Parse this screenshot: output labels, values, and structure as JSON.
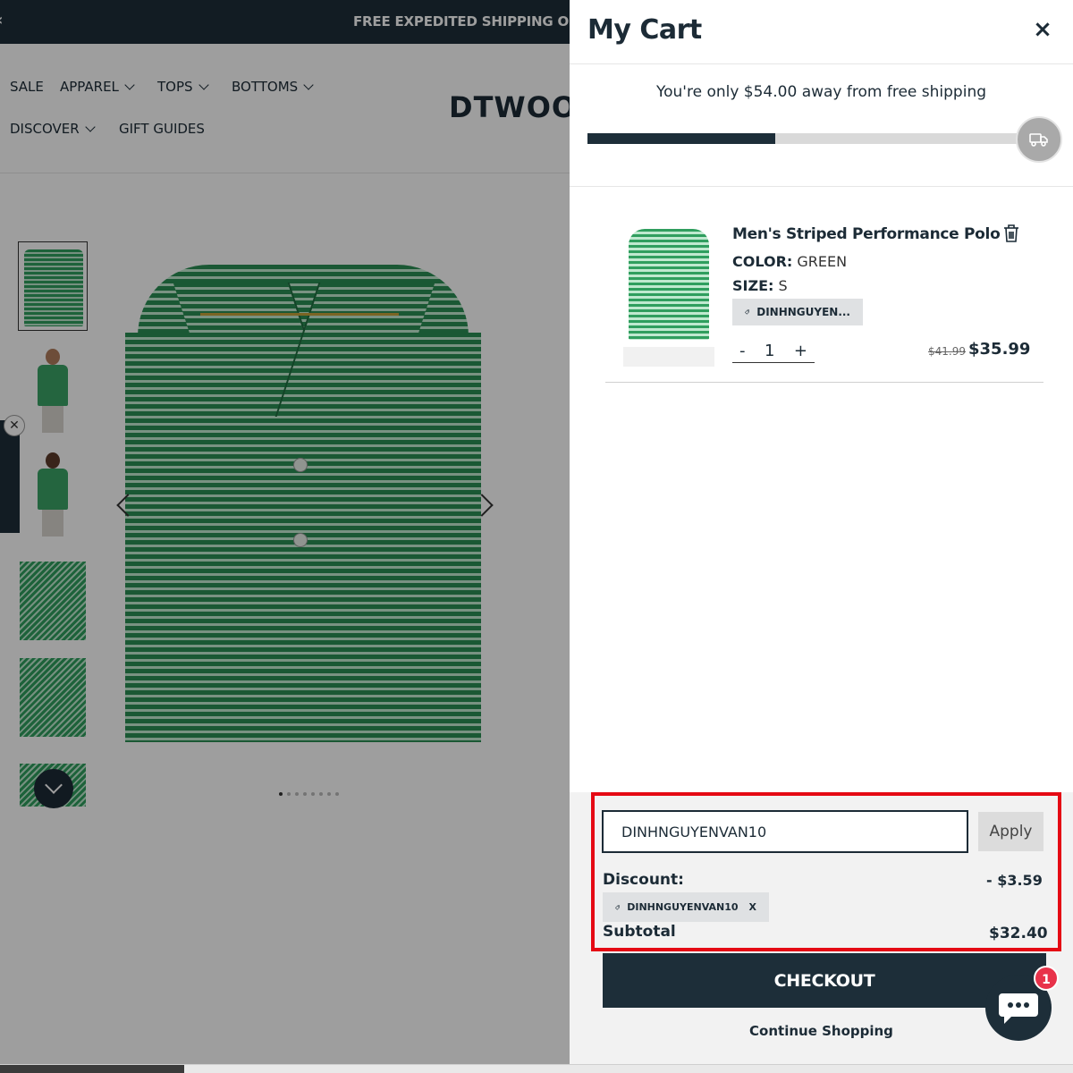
{
  "promo": {
    "text": "FREE EXPEDITED SHIPPING ON"
  },
  "nav": {
    "items": [
      {
        "label": "SALE",
        "dropdown": false
      },
      {
        "label": "APPAREL",
        "dropdown": true
      },
      {
        "label": "TOPS",
        "dropdown": true
      },
      {
        "label": "BOTTOMS",
        "dropdown": true
      },
      {
        "label": "DISCOVER",
        "dropdown": true
      },
      {
        "label": "GIFT GUIDES",
        "dropdown": false
      }
    ],
    "logo": "DTWOO"
  },
  "gallery": {
    "thumbnail_count": 6,
    "active_thumbnail": 0,
    "dot_count": 8,
    "active_dot": 0
  },
  "cart": {
    "title": "My Cart",
    "close_label": "×",
    "shipping_message": "You're only $54.00 away from free shipping",
    "shipping_progress": 0.42,
    "item": {
      "name": "Men's Striped Performance Polo",
      "color_label": "COLOR:",
      "color_value": "GREEN",
      "size_label": "SIZE:",
      "size_value": "S",
      "discount_tag": "DINHNGUYEN...",
      "qty_minus": "-",
      "quantity": "1",
      "qty_plus": "+",
      "price_original": "$41.99",
      "price_current": "$35.99"
    },
    "discount": {
      "code_value": "DINHNGUYENVAN10",
      "apply_label": "Apply",
      "label": "Discount:",
      "amount": "- $3.59",
      "applied_code": "DINHNGUYENVAN10",
      "remove_label": "X"
    },
    "subtotal": {
      "label": "Subtotal",
      "value": "$32.40"
    },
    "checkout_label": "CHECKOUT",
    "continue_label": "Continue Shopping"
  },
  "chat": {
    "badge_count": "1"
  },
  "colors": {
    "primary": "#1d2e39",
    "highlight": "#e50914",
    "badge": "#e8324a",
    "chip": "#dfe1e3"
  }
}
